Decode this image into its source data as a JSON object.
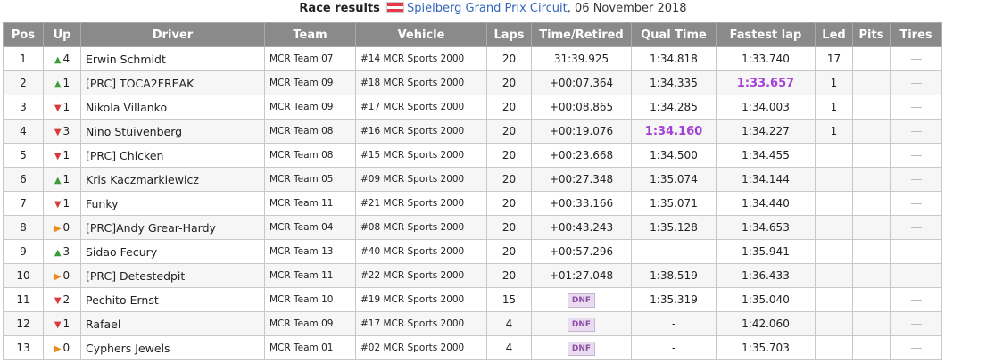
{
  "caption": {
    "label": "Race results",
    "track": "Spielberg Grand Prix Circuit",
    "date": ", 06 November 2018",
    "flag_colors": [
      "#e8384a",
      "#ffffff",
      "#e8384a"
    ]
  },
  "columns": [
    "Pos",
    "Up",
    "Driver",
    "Team",
    "Vehicle",
    "Laps",
    "Time/Retired",
    "Qual Time",
    "Fastest lap",
    "Led",
    "Pits",
    "Tires"
  ],
  "colors": {
    "up": "#3a9d3a",
    "down": "#d63a3a",
    "same": "#f0891a",
    "purple": "#a33fd6",
    "header_bg": "#8a8a8a"
  },
  "rows": [
    {
      "pos": "1",
      "dir": "up",
      "up": "4",
      "driver": "Erwin Schmidt",
      "team": "MCR Team 07",
      "vehicle": "#14 MCR Sports 2000",
      "laps": "20",
      "time": "31:39.925",
      "dnf": false,
      "qual": "1:34.818",
      "qual_fast": false,
      "fastest": "1:33.740",
      "fastest_fast": false,
      "led": "17",
      "pits": "",
      "tires": "—"
    },
    {
      "pos": "2",
      "dir": "up",
      "up": "1",
      "driver": "[PRC] TOCA2FREAK",
      "team": "MCR Team 09",
      "vehicle": "#18 MCR Sports 2000",
      "laps": "20",
      "time": "+00:07.364",
      "dnf": false,
      "qual": "1:34.335",
      "qual_fast": false,
      "fastest": "1:33.657",
      "fastest_fast": true,
      "led": "1",
      "pits": "",
      "tires": "—"
    },
    {
      "pos": "3",
      "dir": "down",
      "up": "1",
      "driver": "Nikola Villanko",
      "team": "MCR Team 09",
      "vehicle": "#17 MCR Sports 2000",
      "laps": "20",
      "time": "+00:08.865",
      "dnf": false,
      "qual": "1:34.285",
      "qual_fast": false,
      "fastest": "1:34.003",
      "fastest_fast": false,
      "led": "1",
      "pits": "",
      "tires": "—"
    },
    {
      "pos": "4",
      "dir": "down",
      "up": "3",
      "driver": "Nino Stuivenberg",
      "team": "MCR Team 08",
      "vehicle": "#16 MCR Sports 2000",
      "laps": "20",
      "time": "+00:19.076",
      "dnf": false,
      "qual": "1:34.160",
      "qual_fast": true,
      "fastest": "1:34.227",
      "fastest_fast": false,
      "led": "1",
      "pits": "",
      "tires": "—"
    },
    {
      "pos": "5",
      "dir": "down",
      "up": "1",
      "driver": "[PRC] Chicken",
      "team": "MCR Team 08",
      "vehicle": "#15 MCR Sports 2000",
      "laps": "20",
      "time": "+00:23.668",
      "dnf": false,
      "qual": "1:34.500",
      "qual_fast": false,
      "fastest": "1:34.455",
      "fastest_fast": false,
      "led": "",
      "pits": "",
      "tires": "—"
    },
    {
      "pos": "6",
      "dir": "up",
      "up": "1",
      "driver": "Kris Kaczmarkiewicz",
      "team": "MCR Team 05",
      "vehicle": "#09 MCR Sports 2000",
      "laps": "20",
      "time": "+00:27.348",
      "dnf": false,
      "qual": "1:35.074",
      "qual_fast": false,
      "fastest": "1:34.144",
      "fastest_fast": false,
      "led": "",
      "pits": "",
      "tires": "—"
    },
    {
      "pos": "7",
      "dir": "down",
      "up": "1",
      "driver": "Funky",
      "team": "MCR Team 11",
      "vehicle": "#21 MCR Sports 2000",
      "laps": "20",
      "time": "+00:33.166",
      "dnf": false,
      "qual": "1:35.071",
      "qual_fast": false,
      "fastest": "1:34.440",
      "fastest_fast": false,
      "led": "",
      "pits": "",
      "tires": "—"
    },
    {
      "pos": "8",
      "dir": "same",
      "up": "0",
      "driver": "[PRC]Andy Grear-Hardy",
      "team": "MCR Team 04",
      "vehicle": "#08 MCR Sports 2000",
      "laps": "20",
      "time": "+00:43.243",
      "dnf": false,
      "qual": "1:35.128",
      "qual_fast": false,
      "fastest": "1:34.653",
      "fastest_fast": false,
      "led": "",
      "pits": "",
      "tires": "—"
    },
    {
      "pos": "9",
      "dir": "up",
      "up": "3",
      "driver": "Sidao Fecury",
      "team": "MCR Team 13",
      "vehicle": "#40 MCR Sports 2000",
      "laps": "20",
      "time": "+00:57.296",
      "dnf": false,
      "qual": "-",
      "qual_fast": false,
      "fastest": "1:35.941",
      "fastest_fast": false,
      "led": "",
      "pits": "",
      "tires": "—"
    },
    {
      "pos": "10",
      "dir": "same",
      "up": "0",
      "driver": "[PRC] Detestedpit",
      "team": "MCR Team 11",
      "vehicle": "#22 MCR Sports 2000",
      "laps": "20",
      "time": "+01:27.048",
      "dnf": false,
      "qual": "1:38.519",
      "qual_fast": false,
      "fastest": "1:36.433",
      "fastest_fast": false,
      "led": "",
      "pits": "",
      "tires": "—"
    },
    {
      "pos": "11",
      "dir": "down",
      "up": "2",
      "driver": "Pechito Ernst",
      "team": "MCR Team 10",
      "vehicle": "#19 MCR Sports 2000",
      "laps": "15",
      "time": "DNF",
      "dnf": true,
      "qual": "1:35.319",
      "qual_fast": false,
      "fastest": "1:35.040",
      "fastest_fast": false,
      "led": "",
      "pits": "",
      "tires": "—"
    },
    {
      "pos": "12",
      "dir": "down",
      "up": "1",
      "driver": "Rafael",
      "team": "MCR Team 09",
      "vehicle": "#17 MCR Sports 2000",
      "laps": "4",
      "time": "DNF",
      "dnf": true,
      "qual": "-",
      "qual_fast": false,
      "fastest": "1:42.060",
      "fastest_fast": false,
      "led": "",
      "pits": "",
      "tires": "—"
    },
    {
      "pos": "13",
      "dir": "same",
      "up": "0",
      "driver": "Cyphers Jewels",
      "team": "MCR Team 01",
      "vehicle": "#02 MCR Sports 2000",
      "laps": "4",
      "time": "DNF",
      "dnf": true,
      "qual": "-",
      "qual_fast": false,
      "fastest": "1:35.703",
      "fastest_fast": false,
      "led": "",
      "pits": "",
      "tires": "—"
    }
  ]
}
